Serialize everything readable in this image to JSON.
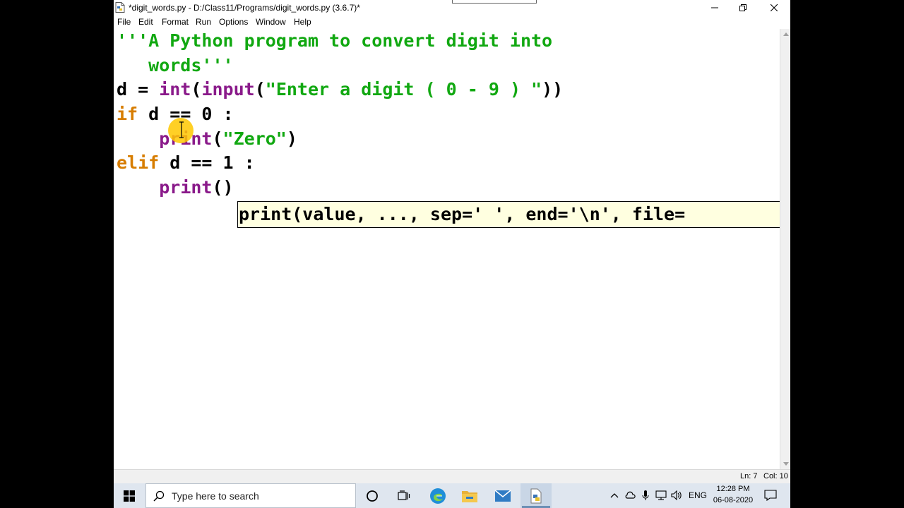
{
  "window": {
    "title": "*digit_words.py - D:/Class11/Programs/digit_words.py (3.6.7)*"
  },
  "menu": {
    "items": [
      "File",
      "Edit",
      "Format",
      "Run",
      "Options",
      "Window",
      "Help"
    ]
  },
  "editor": {
    "lines": [
      {
        "segments": [
          {
            "t": "'''A Python program to convert digit into",
            "k": "str"
          }
        ]
      },
      {
        "segments": [
          {
            "t": "   words'''",
            "k": "str"
          }
        ]
      },
      {
        "segments": [
          {
            "t": "d = ",
            "k": "plain"
          },
          {
            "t": "int",
            "k": "bi"
          },
          {
            "t": "(",
            "k": "plain"
          },
          {
            "t": "input",
            "k": "bi"
          },
          {
            "t": "(",
            "k": "plain"
          },
          {
            "t": "\"Enter a digit ( 0 - 9 ) \"",
            "k": "str"
          },
          {
            "t": "))",
            "k": "plain"
          }
        ]
      },
      {
        "segments": [
          {
            "t": "if",
            "k": "kw"
          },
          {
            "t": " d == 0 :",
            "k": "plain"
          }
        ]
      },
      {
        "segments": [
          {
            "t": "    ",
            "k": "plain"
          },
          {
            "t": "print",
            "k": "bi"
          },
          {
            "t": "(",
            "k": "plain"
          },
          {
            "t": "\"Zero\"",
            "k": "str"
          },
          {
            "t": ")",
            "k": "plain"
          }
        ]
      },
      {
        "segments": [
          {
            "t": "elif",
            "k": "kw"
          },
          {
            "t": " d == 1 :",
            "k": "plain"
          }
        ]
      },
      {
        "segments": [
          {
            "t": "    ",
            "k": "plain"
          },
          {
            "t": "print",
            "k": "bi"
          },
          {
            "t": "()",
            "k": "plain"
          }
        ]
      }
    ],
    "calltip": "print(value, ..., sep=' ', end='\\n', file="
  },
  "status": {
    "line": "Ln: 7",
    "col": "Col: 10"
  },
  "taskbar": {
    "search_placeholder": "Type here to search",
    "lang": "ENG",
    "time": "12:28 PM",
    "date": "06-08-2020"
  },
  "colors": {
    "keyword": "#d77d00",
    "builtin": "#8a1a8a",
    "string": "#11a811",
    "calltip_bg": "#ffffe0",
    "cursor_highlight": "#ffc800"
  }
}
